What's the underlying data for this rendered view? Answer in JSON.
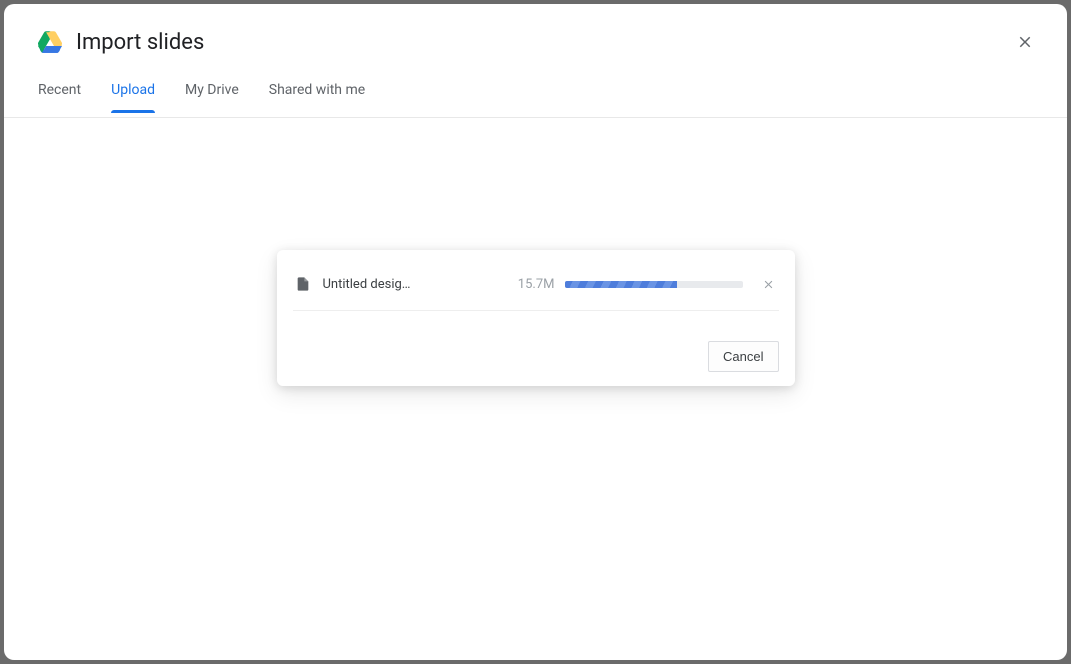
{
  "dialog": {
    "title": "Import slides"
  },
  "tabs": [
    {
      "label": "Recent",
      "active": false
    },
    {
      "label": "Upload",
      "active": true
    },
    {
      "label": "My Drive",
      "active": false
    },
    {
      "label": "Shared with me",
      "active": false
    }
  ],
  "upload": {
    "file_name": "Untitled desig…",
    "file_size": "15.7M",
    "progress_percent": 63,
    "cancel_label": "Cancel"
  }
}
